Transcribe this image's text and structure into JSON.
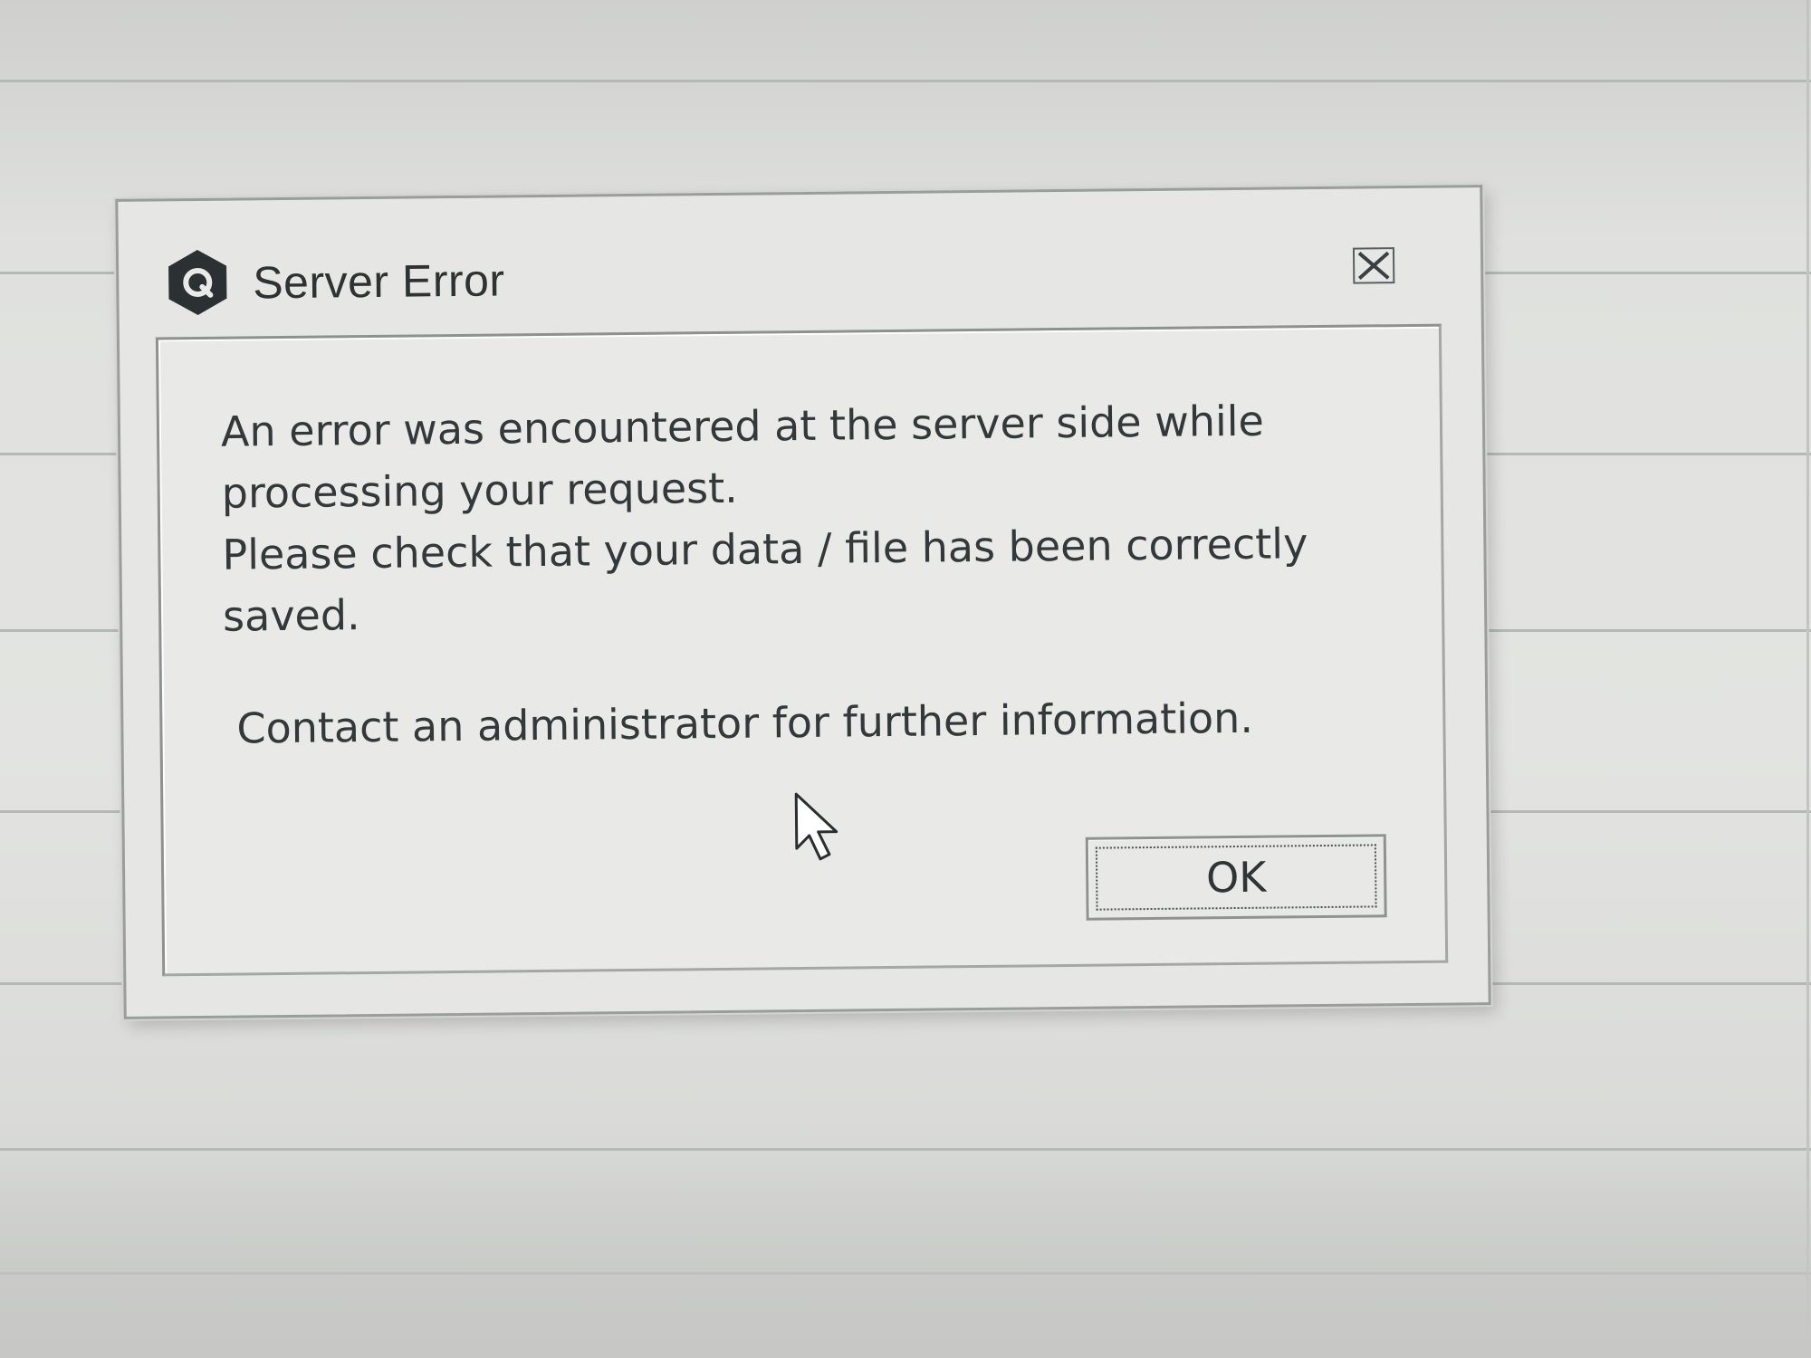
{
  "dialog": {
    "title": "Server Error",
    "app_icon": "hexagon-app-logo-icon",
    "close_icon": "close-x-icon",
    "message_lines": [
      "An error was encountered at the server side while",
      "processing your request.",
      "Please check that your data / file has been correctly",
      "saved."
    ],
    "contact_line": "Contact an administrator for further information.",
    "ok_label": "OK"
  },
  "pointer": {
    "icon": "arrow-cursor-icon"
  },
  "colors": {
    "dialog_background": "#e6e7e5",
    "text": "#33383a",
    "border": "#9a9d9c",
    "screen_background": "#e0e1de"
  }
}
